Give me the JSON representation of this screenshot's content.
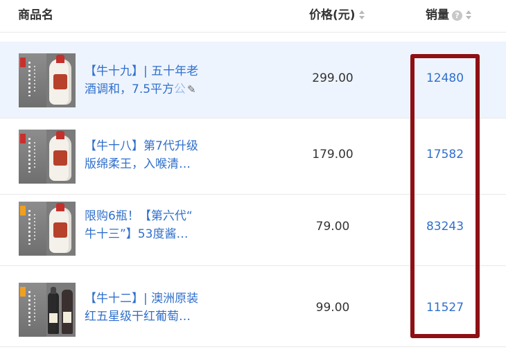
{
  "header": {
    "name_label": "商品名",
    "price_label": "价格(元)",
    "sales_label": "销量",
    "help_icon": "?"
  },
  "products": [
    {
      "title_line1": "【牛十九】| 五十年老",
      "title_line2": "酒调和，7.5平方",
      "title_faded": "公",
      "price": "299.00",
      "sales": "12480"
    },
    {
      "title_line1": "【牛十八】第7代升级",
      "title_line2": "版绵柔王，入喉清…",
      "title_faded": "",
      "price": "179.00",
      "sales": "17582"
    },
    {
      "title_line1": "限购6瓶！【第六代“",
      "title_line2": "牛十三”】53度酱…",
      "title_faded": "",
      "price": "79.00",
      "sales": "83243"
    },
    {
      "title_line1": "【牛十二】| 澳洲原装",
      "title_line2": "红五星级干红葡萄…",
      "title_faded": "",
      "price": "99.00",
      "sales": "11527"
    }
  ],
  "icons": {
    "sort": "sort-icon",
    "edit": "pencil-icon",
    "help": "question-icon"
  },
  "colors": {
    "link": "#2f6fcc",
    "highlight_row": "#eef4fd",
    "annotation_box": "#8e1015"
  }
}
